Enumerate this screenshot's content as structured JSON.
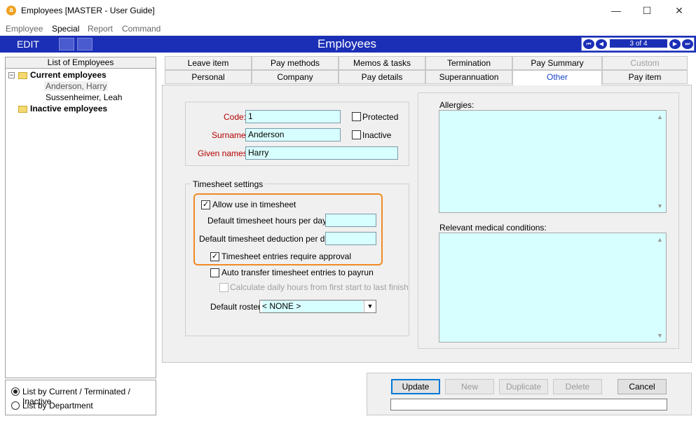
{
  "window": {
    "title": "Employees [MASTER - User Guide]",
    "controls": {
      "minimize": "—",
      "maximize": "☐",
      "close": "✕"
    }
  },
  "menu": [
    "Employee",
    "Special",
    "Report",
    "Command"
  ],
  "toolbar": {
    "edit_label": "EDIT",
    "form_title": "Employees",
    "record_position": "3 of 4"
  },
  "left_panel": {
    "header": "List of Employees",
    "groups": [
      {
        "label": "Current employees",
        "employees": [
          "Anderson, Harry",
          "Sussenheimer, Leah"
        ]
      },
      {
        "label": "Inactive employees",
        "employees": []
      }
    ],
    "list_options": [
      {
        "label": "List by Current / Terminated / Inactive",
        "selected": true
      },
      {
        "label": "List by Department",
        "selected": false
      }
    ]
  },
  "tabs_top": [
    "Leave item",
    "Pay methods",
    "Memos & tasks",
    "Termination",
    "Pay Summary",
    "Custom"
  ],
  "tabs_bottom": [
    "Personal",
    "Company",
    "Pay details",
    "Superannuation",
    "Other",
    "Pay item"
  ],
  "active_tab": "Other",
  "form": {
    "code_label": "Code:",
    "code_value": "1",
    "surname_label": "Surname:",
    "surname_value": "Anderson",
    "given_names_label": "Given names:",
    "given_names_value": "Harry",
    "protected_label": "Protected",
    "protected_checked": false,
    "inactive_label": "Inactive",
    "inactive_checked": false
  },
  "timesheet": {
    "group_label": "Timesheet settings",
    "allow_use_label": "Allow use in timesheet",
    "allow_use_checked": true,
    "hours_label": "Default timesheet hours per day:",
    "hours_value": "",
    "deduction_label": "Default timesheet deduction per day:",
    "deduction_value": "",
    "approval_label": "Timesheet entries require approval",
    "approval_checked": true,
    "auto_transfer_label": "Auto transfer timesheet entries to payrun",
    "auto_transfer_checked": false,
    "calc_daily_label": "Calculate daily hours from first start to last finish",
    "calc_daily_checked": false,
    "roster_label": "Default roster:",
    "roster_value": "< NONE >"
  },
  "medical": {
    "allergies_label": "Allergies:",
    "allergies_value": "",
    "conditions_label": "Relevant medical conditions:",
    "conditions_value": ""
  },
  "buttons": {
    "update": "Update",
    "new": "New",
    "duplicate": "Duplicate",
    "delete": "Delete",
    "cancel": "Cancel"
  },
  "colors": {
    "toolbar_blue": "#1b2fb6",
    "field_cyan": "#d8ffff",
    "highlight_orange": "#f08a24",
    "required_red": "#b40000",
    "active_tab_blue": "#1a46c8"
  }
}
